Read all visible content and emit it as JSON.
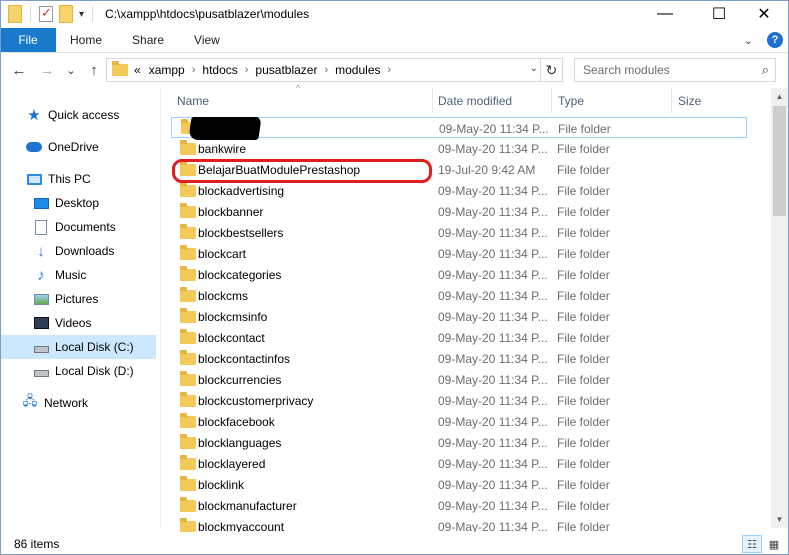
{
  "titlebar": {
    "path": "C:\\xampp\\htdocs\\pusatblazer\\modules",
    "minimize": "—",
    "maximize": "☐",
    "close": "✕",
    "qa_dropdown": "▾"
  },
  "ribbon": {
    "file_tab": "File",
    "tabs": [
      "Home",
      "Share",
      "View"
    ],
    "expand_icon": "⌄",
    "help": "?"
  },
  "navigation": {
    "back": "←",
    "forward": "→",
    "recent": "⌄",
    "up": "↑"
  },
  "address": {
    "overflow": "«",
    "crumbs": [
      "xampp",
      "htdocs",
      "pusatblazer",
      "modules"
    ],
    "separator": "›",
    "dropdown": "⌄",
    "refresh": "↻"
  },
  "search": {
    "placeholder": "Search modules",
    "icon": "⌕"
  },
  "nav_pane": {
    "items": [
      {
        "label": "Quick access",
        "icon": "star-icon"
      },
      {
        "label": "OneDrive",
        "icon": "cloud-icon"
      },
      {
        "label": "This PC",
        "icon": "computer-icon"
      },
      {
        "label": "Desktop",
        "icon": "desktop-icon"
      },
      {
        "label": "Documents",
        "icon": "documents-icon"
      },
      {
        "label": "Downloads",
        "icon": "download-icon"
      },
      {
        "label": "Music",
        "icon": "music-icon"
      },
      {
        "label": "Pictures",
        "icon": "pictures-icon"
      },
      {
        "label": "Videos",
        "icon": "videos-icon"
      },
      {
        "label": "Local Disk (C:)",
        "icon": "drive-icon",
        "selected": true
      },
      {
        "label": "Local Disk (D:)",
        "icon": "drive-icon"
      },
      {
        "label": "Network",
        "icon": "network-icon"
      }
    ]
  },
  "columns": {
    "name": "Name",
    "date": "Date modified",
    "type": "Type",
    "size": "Size",
    "sort_indicator": "^"
  },
  "files": [
    {
      "name": "",
      "date": "09-May-20 11:34 P...",
      "type": "File folder",
      "redacted": true
    },
    {
      "name": "bankwire",
      "date": "09-May-20 11:34 P...",
      "type": "File folder"
    },
    {
      "name": "BelajarBuatModulePrestashop",
      "date": "19-Jul-20 9:42 AM",
      "type": "File folder",
      "highlighted": true
    },
    {
      "name": "blockadvertising",
      "date": "09-May-20 11:34 P...",
      "type": "File folder"
    },
    {
      "name": "blockbanner",
      "date": "09-May-20 11:34 P...",
      "type": "File folder"
    },
    {
      "name": "blockbestsellers",
      "date": "09-May-20 11:34 P...",
      "type": "File folder"
    },
    {
      "name": "blockcart",
      "date": "09-May-20 11:34 P...",
      "type": "File folder"
    },
    {
      "name": "blockcategories",
      "date": "09-May-20 11:34 P...",
      "type": "File folder"
    },
    {
      "name": "blockcms",
      "date": "09-May-20 11:34 P...",
      "type": "File folder"
    },
    {
      "name": "blockcmsinfo",
      "date": "09-May-20 11:34 P...",
      "type": "File folder"
    },
    {
      "name": "blockcontact",
      "date": "09-May-20 11:34 P...",
      "type": "File folder"
    },
    {
      "name": "blockcontactinfos",
      "date": "09-May-20 11:34 P...",
      "type": "File folder"
    },
    {
      "name": "blockcurrencies",
      "date": "09-May-20 11:34 P...",
      "type": "File folder"
    },
    {
      "name": "blockcustomerprivacy",
      "date": "09-May-20 11:34 P...",
      "type": "File folder"
    },
    {
      "name": "blockfacebook",
      "date": "09-May-20 11:34 P...",
      "type": "File folder"
    },
    {
      "name": "blocklanguages",
      "date": "09-May-20 11:34 P...",
      "type": "File folder"
    },
    {
      "name": "blocklayered",
      "date": "09-May-20 11:34 P...",
      "type": "File folder"
    },
    {
      "name": "blocklink",
      "date": "09-May-20 11:34 P...",
      "type": "File folder"
    },
    {
      "name": "blockmanufacturer",
      "date": "09-May-20 11:34 P...",
      "type": "File folder"
    },
    {
      "name": "blockmyaccount",
      "date": "09-May-20 11:34 P...",
      "type": "File folder"
    }
  ],
  "scrollbar": {
    "up": "▲",
    "down": "▼"
  },
  "status": {
    "item_count": "86 items",
    "details_view": "☷",
    "tiles_view": "▦"
  },
  "colors": {
    "accent": "#1979ca",
    "selection": "#cce8ff",
    "highlight_ring": "#e01c1c"
  }
}
